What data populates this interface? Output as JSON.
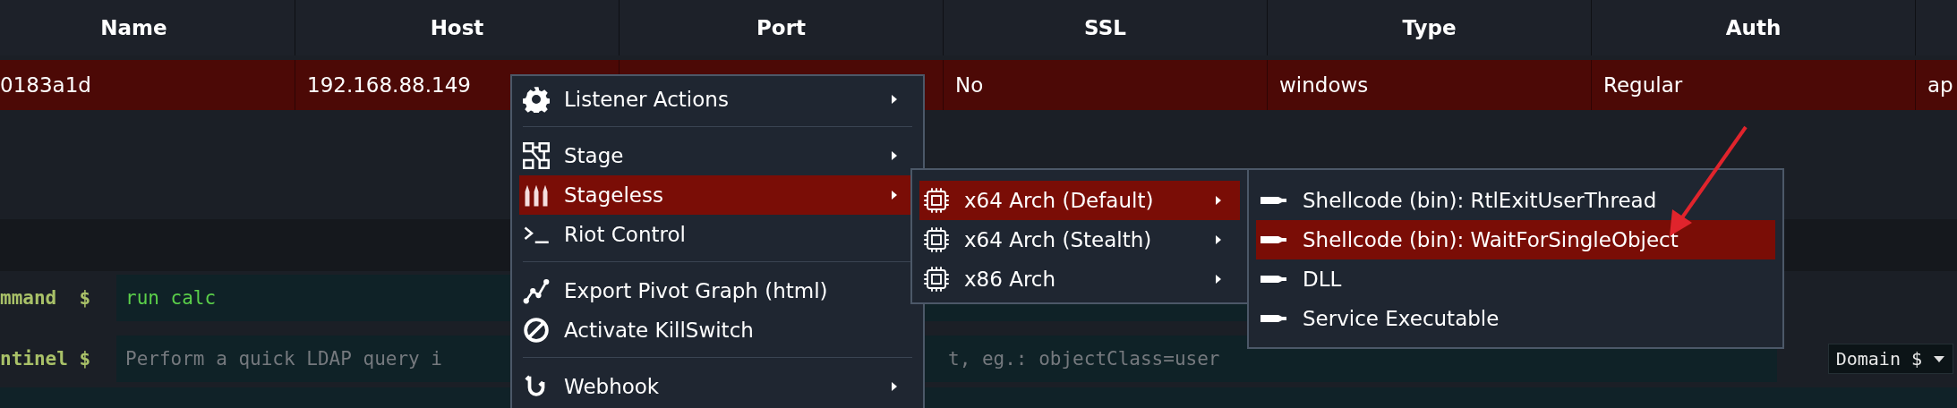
{
  "table": {
    "columns": [
      "Name",
      "Host",
      "Port",
      "SSL",
      "Type",
      "Auth"
    ],
    "rows": [
      {
        "selected": true,
        "cells": [
          "0183a1d",
          "192.168.88.149",
          null,
          "No",
          "windows",
          "Regular",
          "ap"
        ]
      }
    ]
  },
  "console": [
    {
      "prompt": "mmand  $",
      "value": "run calc"
    },
    {
      "prompt": "ntinel $",
      "placeholder": "Perform a quick LDAP query i",
      "placeholder_tail": "t, eg.: objectClass=user",
      "dropdown": "Domain $"
    }
  ],
  "context_menu": {
    "items": [
      {
        "kind": "gear",
        "label": "Listener Actions",
        "submenu": true,
        "selected": false,
        "separator_after": true
      },
      {
        "kind": "nodes",
        "label": "Stage",
        "submenu": true,
        "selected": false,
        "separator_after": false
      },
      {
        "kind": "ammo",
        "label": "Stageless",
        "submenu": true,
        "selected": true,
        "separator_after": false
      },
      {
        "kind": "terminal",
        "label": "Riot Control",
        "submenu": false,
        "selected": false,
        "separator_after": true
      },
      {
        "kind": "graph",
        "label": "Export Pivot Graph (html)",
        "submenu": false,
        "selected": false,
        "separator_after": false
      },
      {
        "kind": "ban",
        "label": "Activate KillSwitch",
        "submenu": false,
        "selected": false,
        "separator_after": true
      },
      {
        "kind": "hook",
        "label": "Webhook",
        "submenu": true,
        "selected": false,
        "separator_after": false
      }
    ]
  },
  "arch_menu": {
    "items": [
      {
        "kind": "chip",
        "label": "x64 Arch (Default)",
        "submenu": true,
        "selected": true
      },
      {
        "kind": "chip",
        "label": "x64 Arch (Stealth)",
        "submenu": true,
        "selected": false
      },
      {
        "kind": "chip",
        "label": "x86 Arch",
        "submenu": true,
        "selected": false
      }
    ]
  },
  "format_menu": {
    "items": [
      {
        "kind": "bullet",
        "label": "Shellcode (bin): RtlExitUserThread",
        "selected": false
      },
      {
        "kind": "bullet",
        "label": "Shellcode (bin): WaitForSingleObject",
        "selected": true
      },
      {
        "kind": "bullet",
        "label": "DLL",
        "selected": false
      },
      {
        "kind": "bullet",
        "label": "Service Executable",
        "selected": false
      }
    ]
  }
}
